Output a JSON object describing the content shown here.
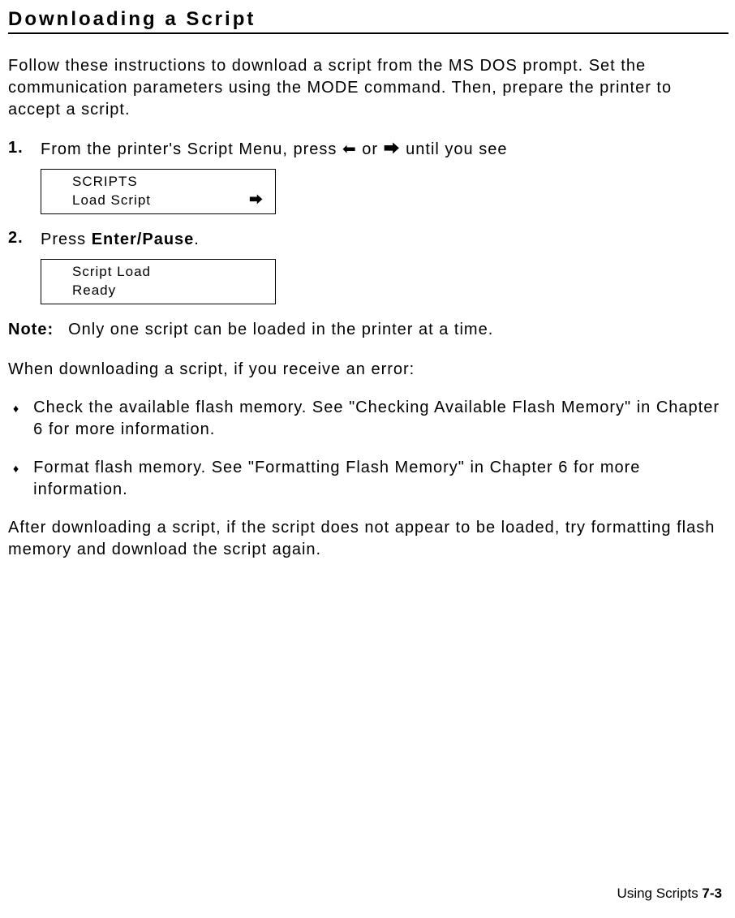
{
  "heading": "Downloading a Script",
  "intro": "Follow these instructions to download a script from the MS DOS prompt.  Set the communication parameters using the MODE command.  Then, prepare the printer to accept a script.",
  "step1": {
    "num": "1.",
    "text_before": "From the printer's Script Menu, press ",
    "arrow_left": "⬅",
    "or": " or ",
    "arrow_right": "⮕",
    "text_after": " until you see"
  },
  "display1": {
    "line1": "SCRIPTS",
    "line2_label": "Load Script",
    "line2_arrow": "⮕"
  },
  "step2": {
    "num": "2.",
    "text_before": "Press ",
    "bold": "Enter/Pause",
    "text_after": "."
  },
  "display2": {
    "line1": "Script Load",
    "line2": "Ready"
  },
  "note": {
    "label": "Note:",
    "text": "Only one script can be loaded in the printer at a time."
  },
  "error_intro": "When downloading a script, if you receive an error:",
  "bullets": [
    "Check the available flash memory.  See \"Checking Available Flash Memory\" in Chapter 6 for more information.",
    "Format flash memory.  See \"Formatting Flash Memory\" in Chapter 6 for more information."
  ],
  "after": "After downloading a script, if the script does not appear to be loaded, try formatting flash memory and download the script again.",
  "footer": {
    "label": "Using Scripts ",
    "page": "7-3"
  }
}
